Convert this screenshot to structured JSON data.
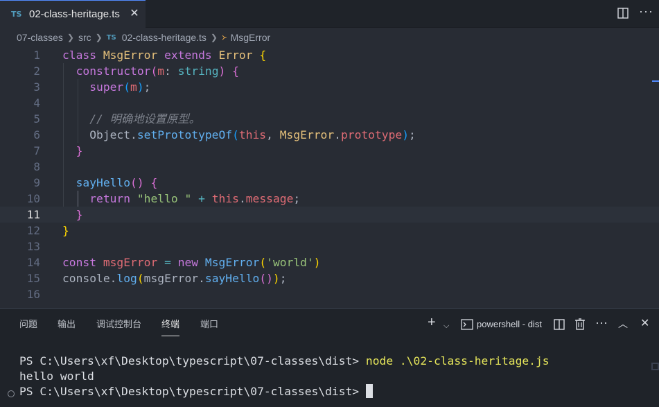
{
  "tab": {
    "badge": "TS",
    "title": "02-class-heritage.ts",
    "close": "✕"
  },
  "breadcrumb": {
    "items": [
      "07-classes",
      "src"
    ],
    "file_badge": "TS",
    "file": "02-class-heritage.ts",
    "symbol": "MsgError"
  },
  "editor": {
    "line_numbers": [
      "1",
      "2",
      "3",
      "4",
      "5",
      "6",
      "7",
      "8",
      "9",
      "10",
      "11",
      "12",
      "13",
      "14",
      "15",
      "16"
    ],
    "current_line": 11
  },
  "panel": {
    "tabs": [
      "问题",
      "输出",
      "调试控制台",
      "终端",
      "端口"
    ],
    "active_tab": "终端",
    "terminal_name": "powershell - dist",
    "terminal_lines": [
      {
        "prompt": "PS C:\\Users\\xf\\Desktop\\typescript\\07-classes\\dist> ",
        "command": "node .\\02-class-heritage.js"
      },
      {
        "output": "hello world"
      },
      {
        "prompt": "PS C:\\Users\\xf\\Desktop\\typescript\\07-classes\\dist> "
      }
    ]
  },
  "colors": {
    "accent": "#528bff",
    "editor_bg": "#282c34",
    "panel_bg": "#1f2329",
    "keyword": "#c678dd",
    "class": "#e5c07b",
    "function": "#61afef",
    "string": "#98c379"
  }
}
